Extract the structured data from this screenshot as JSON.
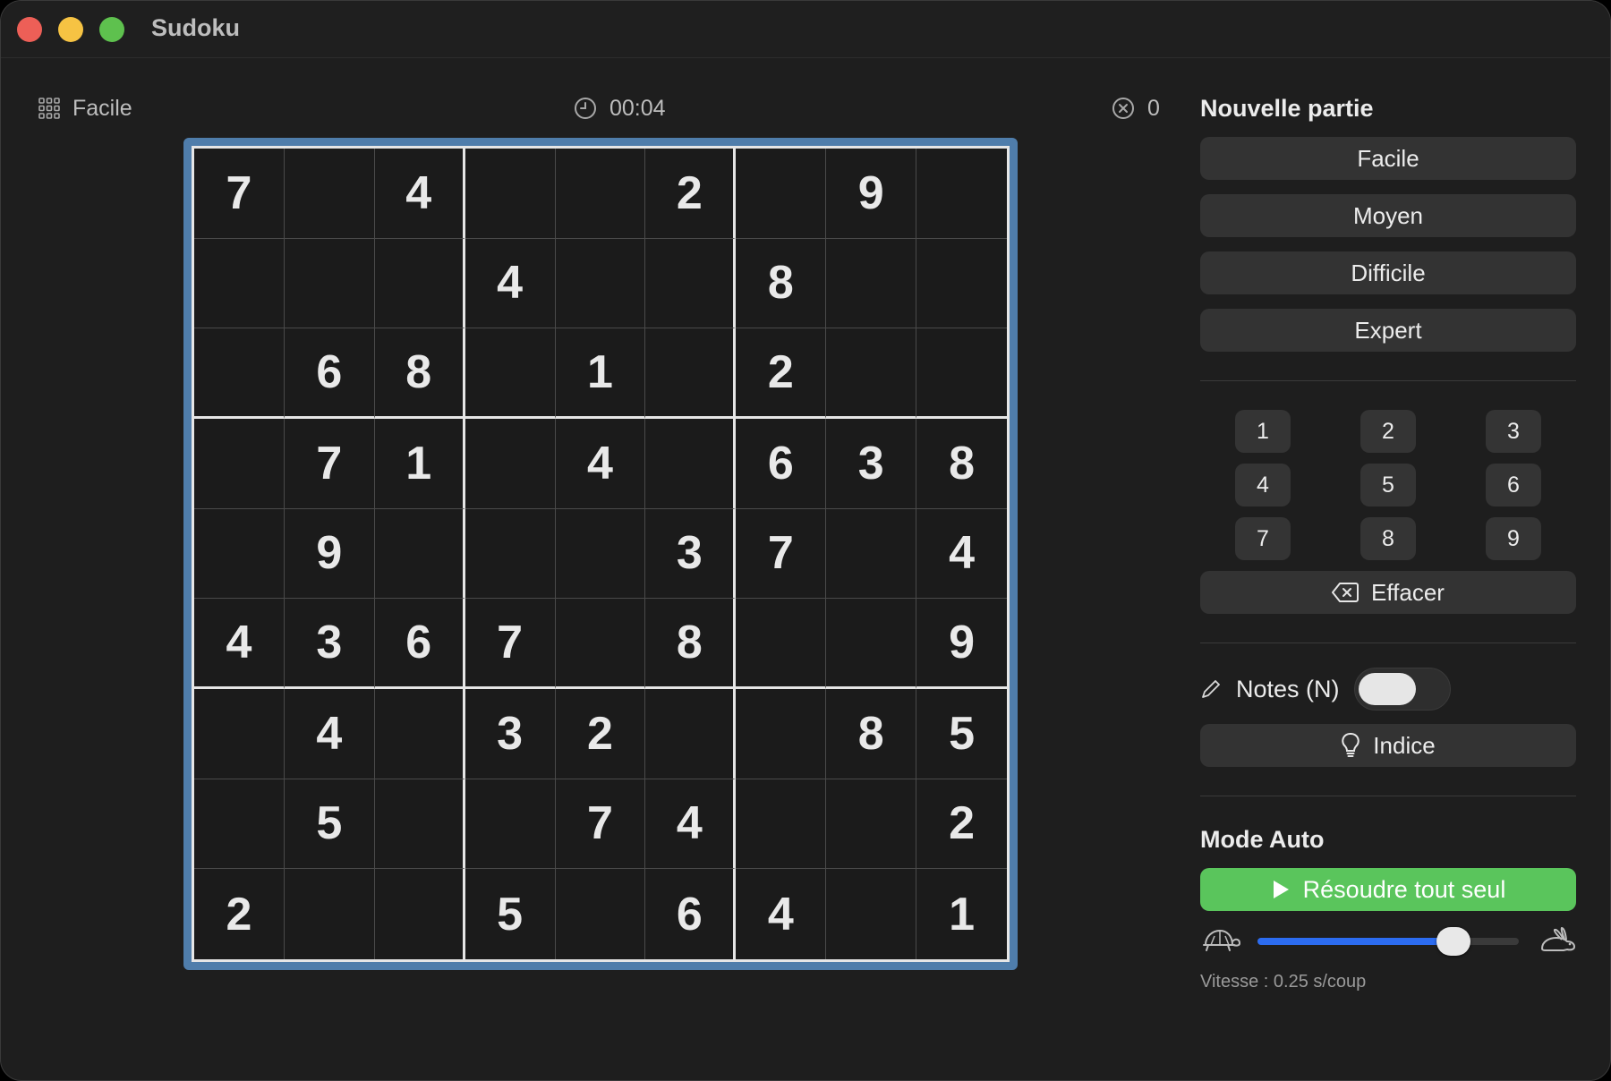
{
  "window": {
    "title": "Sudoku"
  },
  "status": {
    "level_icon": "grid-icon",
    "level": "Facile",
    "timer_icon": "clock-icon",
    "timer": "00:04",
    "errors_icon": "error-x-circle-icon",
    "errors": "0"
  },
  "board": {
    "border_color": "#4f7dab",
    "cells": [
      [
        "7",
        "",
        "4",
        "",
        "",
        "2",
        "",
        "9",
        ""
      ],
      [
        "",
        "",
        "",
        "4",
        "",
        "",
        "8",
        "",
        ""
      ],
      [
        "",
        "6",
        "8",
        "",
        "1",
        "",
        "2",
        "",
        ""
      ],
      [
        "",
        "7",
        "1",
        "",
        "4",
        "",
        "6",
        "3",
        "8"
      ],
      [
        "",
        "9",
        "",
        "",
        "",
        "3",
        "7",
        "",
        "4"
      ],
      [
        "4",
        "3",
        "6",
        "7",
        "",
        "8",
        "",
        "",
        "9"
      ],
      [
        "",
        "4",
        "",
        "3",
        "2",
        "",
        "",
        "8",
        "5"
      ],
      [
        "",
        "5",
        "",
        "",
        "7",
        "4",
        "",
        "",
        "2"
      ],
      [
        "2",
        "",
        "",
        "5",
        "",
        "6",
        "4",
        "",
        "1"
      ]
    ]
  },
  "new_game": {
    "title": "Nouvelle partie",
    "buttons": [
      "Facile",
      "Moyen",
      "Difficile",
      "Expert"
    ]
  },
  "numpad": {
    "digits": [
      "1",
      "2",
      "3",
      "4",
      "5",
      "6",
      "7",
      "8",
      "9"
    ],
    "erase_label": "Effacer",
    "erase_icon": "delete-backspace-icon"
  },
  "notes": {
    "label": "Notes (N)",
    "icon": "pencil-icon",
    "enabled": false
  },
  "hint": {
    "label": "Indice",
    "icon": "lightbulb-icon"
  },
  "auto": {
    "title": "Mode Auto",
    "solve_label": "Résoudre tout seul",
    "solve_icon": "play-icon",
    "accent": "#5ac55c",
    "slow_icon": "tortoise-icon",
    "fast_icon": "hare-icon",
    "speed_fraction": 0.75,
    "speed_label": "Vitesse : 0.25 s/coup",
    "slider_color": "#2c6cf0"
  }
}
